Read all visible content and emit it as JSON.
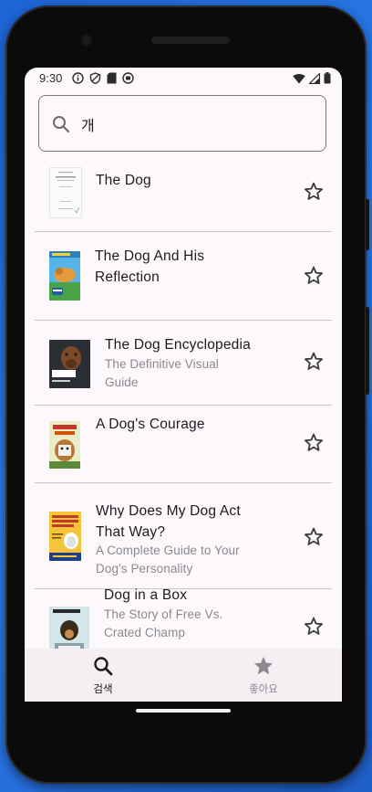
{
  "status_bar": {
    "time": "9:30"
  },
  "search": {
    "value": "개"
  },
  "books": [
    {
      "title_lines": [
        "The Dog"
      ],
      "subtitle_lines": []
    },
    {
      "title_lines": [
        "The Dog And His",
        "Reflection"
      ],
      "subtitle_lines": []
    },
    {
      "title_lines": [
        "The Dog Encyclopedia"
      ],
      "subtitle_lines": [
        "The Definitive Visual",
        "Guide"
      ]
    },
    {
      "title_lines": [
        "A Dog's Courage"
      ],
      "subtitle_lines": []
    },
    {
      "title_lines": [
        "Why Does My Dog Act",
        "That Way?"
      ],
      "subtitle_lines": [
        "A Complete Guide to Your",
        "Dog's Personality"
      ]
    },
    {
      "title_lines": [
        "Dog in a Box"
      ],
      "subtitle_lines": [
        "The Story of Free Vs.",
        "Crated Champ"
      ]
    }
  ],
  "bottom_nav": {
    "search_label": "검색",
    "favorites_label": "좋아요"
  },
  "colors": {
    "screen_bg": "#fdf8fc",
    "divider": "#c9c5ca",
    "nav_bg": "#f5eff4",
    "active_icon": "#1c1b1f",
    "inactive_icon": "#8a8a8e"
  },
  "icons": {
    "search": "search-icon",
    "star_outline": "star-outline-icon",
    "star_filled": "star-filled-icon"
  }
}
